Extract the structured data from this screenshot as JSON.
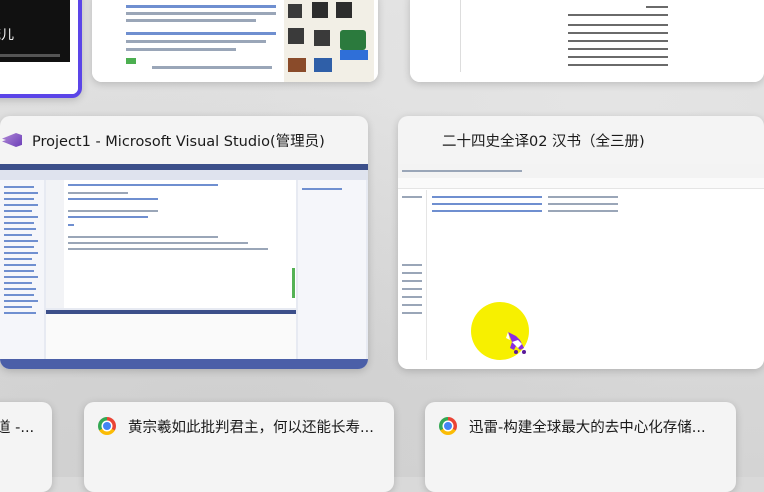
{
  "windows": {
    "top_left_partial_text": "茂儿",
    "visual_studio": {
      "title": "Project1 - Microsoft Visual Studio(管理员)",
      "icon": "visual-studio-icon"
    },
    "file_explorer": {
      "title": "二十四史全译02 汉书（全三册)"
    },
    "chrome_partial": {
      "title": "道 -...",
      "icon": "chrome-icon"
    },
    "chrome_1": {
      "title": "黄宗羲如此批判君主，何以还能长寿...",
      "icon": "chrome-icon"
    },
    "chrome_2": {
      "title": "迅雷-构建全球最大的去中心化存储...",
      "icon": "chrome-icon"
    }
  },
  "colors": {
    "selection_border": "#5b45e8",
    "cursor_highlight": "#f7f000"
  },
  "cursor": {
    "icon": "pony-cursor-icon"
  }
}
